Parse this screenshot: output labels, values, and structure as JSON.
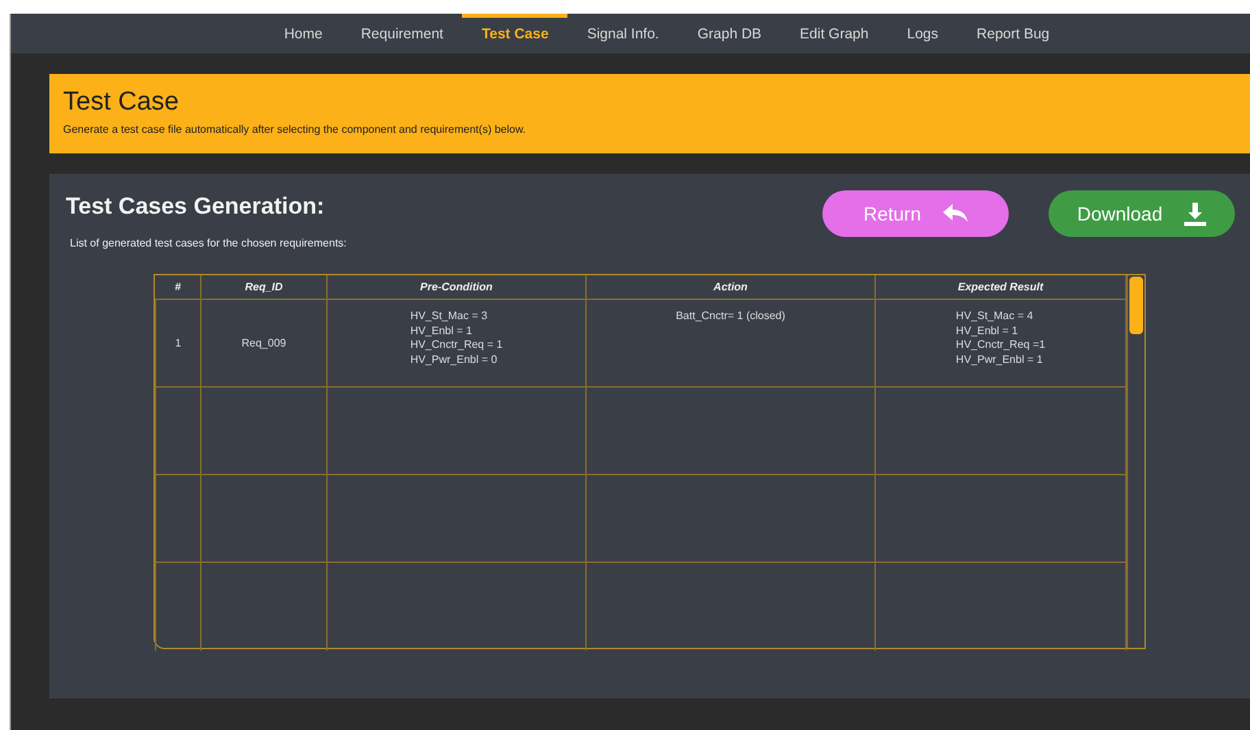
{
  "nav": [
    {
      "label": "Home",
      "selected": false
    },
    {
      "label": "Requirement",
      "selected": false
    },
    {
      "label": "Test Case",
      "selected": true
    },
    {
      "label": "Signal Info.",
      "selected": false
    },
    {
      "label": "Graph DB",
      "selected": false
    },
    {
      "label": "Edit Graph",
      "selected": false
    },
    {
      "label": "Logs",
      "selected": false
    },
    {
      "label": "Report Bug",
      "selected": false
    }
  ],
  "banner": {
    "title": "Test Case",
    "subtitle": "Generate a test case file automatically after selecting the component and requirement(s) below."
  },
  "panel": {
    "title": "Test Cases Generation:",
    "description": "List of generated test cases for the chosen requirements:",
    "buttons": [
      {
        "label": "Return",
        "kind": "return"
      },
      {
        "label": "Download",
        "kind": "download"
      }
    ]
  },
  "table": {
    "columns": [
      "#",
      "Req_ID",
      "Pre-Condition",
      "Action",
      "Expected Result"
    ],
    "rows": [
      {
        "cells": [
          "1",
          "Req_009",
          [
            "HV_St_Mac = 3",
            "HV_Enbl = 1",
            "HV_Cnctr_Req = 1",
            "HV_Pwr_Enbl = 0"
          ],
          [
            "Batt_Cnctr= 1 (closed)"
          ],
          [
            "HV_St_Mac = 4",
            "HV_Enbl = 1",
            "HV_Cnctr_Req =1",
            "HV_Pwr_Enbl = 1"
          ]
        ]
      }
    ]
  }
}
